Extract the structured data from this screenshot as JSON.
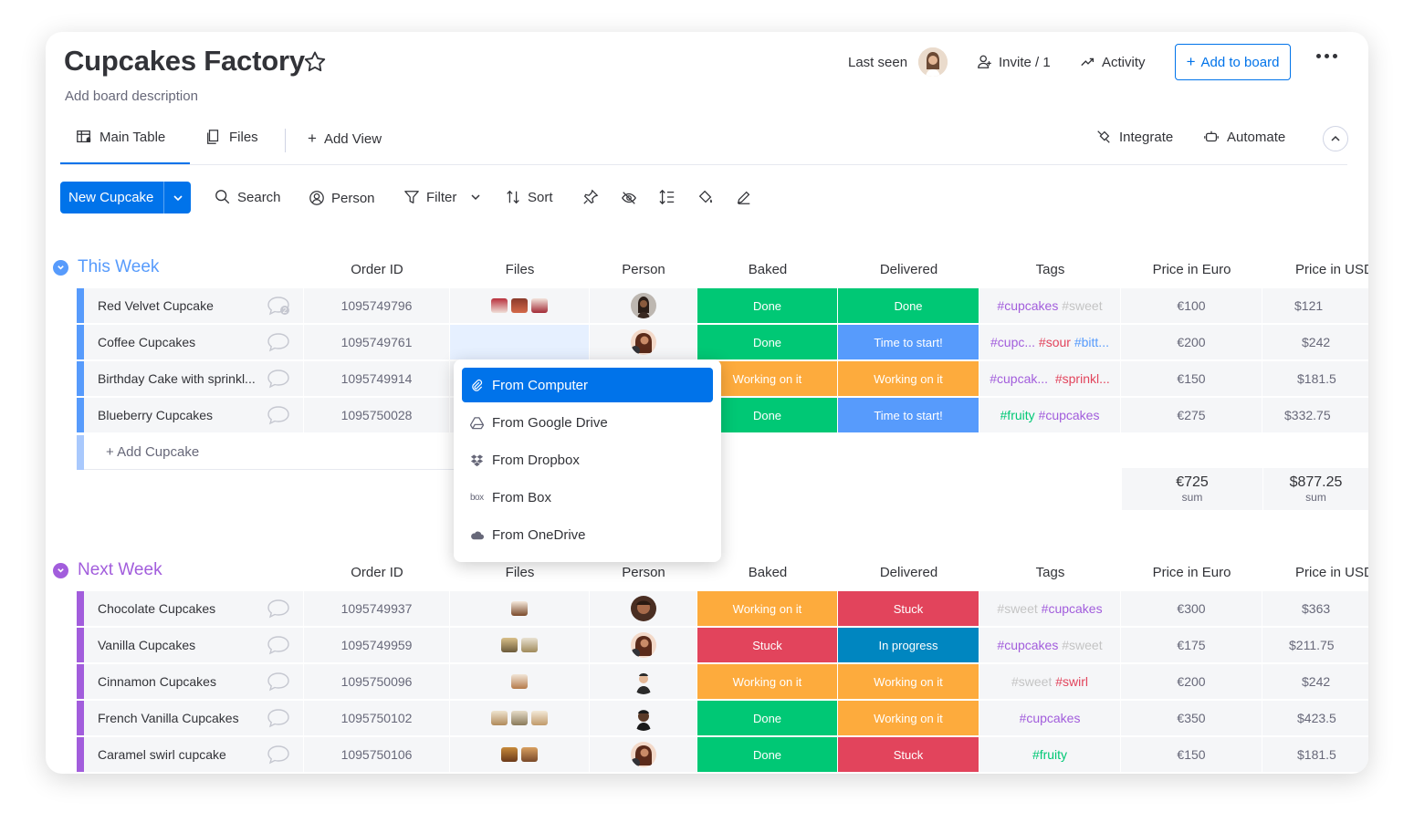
{
  "board": {
    "title": "Cupcakes Factory",
    "description": "Add board description"
  },
  "header": {
    "last_seen": "Last seen",
    "invite": "Invite / 1",
    "activity": "Activity",
    "add_to_board": "Add to board"
  },
  "tabs": {
    "main_table": "Main Table",
    "files": "Files",
    "add_view": "Add View",
    "integrate": "Integrate",
    "automate": "Automate"
  },
  "toolbar": {
    "new_item": "New Cupcake",
    "search": "Search",
    "person": "Person",
    "filter": "Filter",
    "sort": "Sort"
  },
  "columns": [
    "Order ID",
    "Files",
    "Person",
    "Baked",
    "Delivered",
    "Tags",
    "Price in Euro",
    "Price in USD"
  ],
  "colors": {
    "done": "#00c875",
    "time_to_start": "#579bfc",
    "working": "#fdab3d",
    "stuck": "#e2445c",
    "in_progress": "#0086c0",
    "group1": "#579bfc",
    "group2": "#a25ddc",
    "accent": "#0073ea"
  },
  "groups": [
    {
      "title": "This Week",
      "add_item": "+ Add Cupcake",
      "rows": [
        {
          "name": "Red Velvet Cupcake",
          "comments": "2",
          "order_id": "1095749796",
          "baked": "Done",
          "delivered": "Done",
          "tags": [
            {
              "t": "#cupcakes",
              "c": "#a25ddc"
            },
            {
              "t": "#sweet",
              "c": "#c4c4c4"
            }
          ],
          "eur": "€100",
          "usd": "$121"
        },
        {
          "name": "Coffee Cupcakes",
          "comments": "",
          "order_id": "1095749761",
          "baked": "Done",
          "delivered": "Time to start!",
          "tags": [
            {
              "t": "#cupc...",
              "c": "#a25ddc"
            },
            {
              "t": "#sour",
              "c": "#e2445c"
            },
            {
              "t": "#bitt...",
              "c": "#579bfc"
            }
          ],
          "eur": "€200",
          "usd": "$242"
        },
        {
          "name": "Birthday Cake with sprinkl...",
          "comments": "",
          "order_id": "1095749914",
          "baked": "Working on it",
          "delivered": "Working on it",
          "tags": [
            {
              "t": "#cupcak...",
              "c": "#a25ddc"
            },
            {
              "t": "#sprinkl...",
              "c": "#e2445c"
            }
          ],
          "eur": "€150",
          "usd": "$181.5"
        },
        {
          "name": "Blueberry Cupcakes",
          "comments": "",
          "order_id": "1095750028",
          "baked": "Done",
          "delivered": "Time to start!",
          "tags": [
            {
              "t": "#fruity",
              "c": "#00c875"
            },
            {
              "t": "#cupcakes",
              "c": "#a25ddc"
            }
          ],
          "eur": "€275",
          "usd": "$332.75"
        }
      ],
      "sum_eur": "€725",
      "sum_usd": "$877.25",
      "sum_label": "sum"
    },
    {
      "title": "Next Week",
      "rows": [
        {
          "name": "Chocolate Cupcakes",
          "order_id": "1095749937",
          "baked": "Working on it",
          "delivered": "Stuck",
          "tags": [
            {
              "t": "#sweet",
              "c": "#c4c4c4"
            },
            {
              "t": "#cupcakes",
              "c": "#a25ddc"
            }
          ],
          "eur": "€300",
          "usd": "$363"
        },
        {
          "name": "Vanilla Cupcakes",
          "order_id": "1095749959",
          "baked": "Stuck",
          "delivered": "In progress",
          "tags": [
            {
              "t": "#cupcakes",
              "c": "#a25ddc"
            },
            {
              "t": "#sweet",
              "c": "#c4c4c4"
            }
          ],
          "eur": "€175",
          "usd": "$211.75"
        },
        {
          "name": "Cinnamon Cupcakes",
          "order_id": "1095750096",
          "baked": "Working on it",
          "delivered": "Working on it",
          "tags": [
            {
              "t": "#sweet",
              "c": "#c4c4c4"
            },
            {
              "t": "#swirl",
              "c": "#e2445c"
            }
          ],
          "eur": "€200",
          "usd": "$242"
        },
        {
          "name": "French Vanilla Cupcakes",
          "order_id": "1095750102",
          "baked": "Done",
          "delivered": "Working on it",
          "tags": [
            {
              "t": "#cupcakes",
              "c": "#a25ddc"
            }
          ],
          "eur": "€350",
          "usd": "$423.5"
        },
        {
          "name": "Caramel swirl cupcake",
          "order_id": "1095750106",
          "baked": "Done",
          "delivered": "Stuck",
          "tags": [
            {
              "t": "#fruity",
              "c": "#00c875"
            }
          ],
          "eur": "€150",
          "usd": "$181.5"
        }
      ]
    }
  ],
  "file_menu": {
    "items": [
      "From Computer",
      "From Google Drive",
      "From Dropbox",
      "From Box",
      "From OneDrive"
    ],
    "box_logo_text": "box"
  }
}
